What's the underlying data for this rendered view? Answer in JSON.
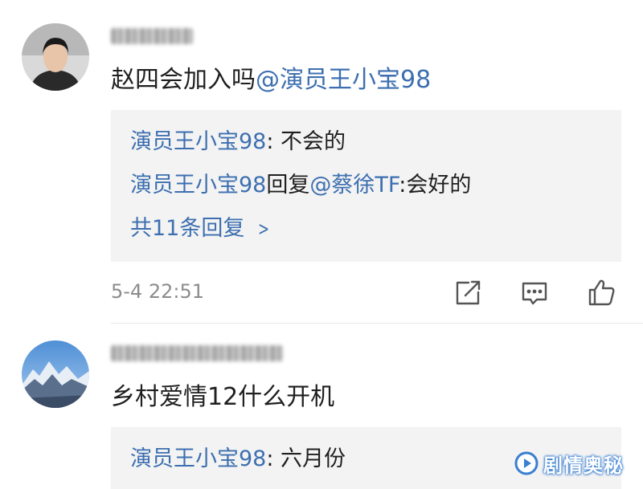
{
  "comments": [
    {
      "text": "赵四会加入吗",
      "mention": "@演员王小宝98",
      "replies": [
        {
          "author": "演员王小宝98",
          "sep": ": ",
          "text": "不会的"
        },
        {
          "author": "演员王小宝98",
          "verb": "回复",
          "target": "@蔡徐TF",
          "sep": ":",
          "text": "会好的"
        }
      ],
      "more_replies": "共11条回复",
      "timestamp": "5-4 22:51",
      "actions": [
        "share-icon",
        "comment-icon",
        "like-icon"
      ]
    },
    {
      "text": "乡村爱情12什么开机",
      "replies": [
        {
          "author": "演员王小宝98",
          "sep": ": ",
          "text": "六月份"
        }
      ]
    }
  ],
  "watermark": {
    "text": "剧情奥秘",
    "color": "#3a7fd0"
  }
}
